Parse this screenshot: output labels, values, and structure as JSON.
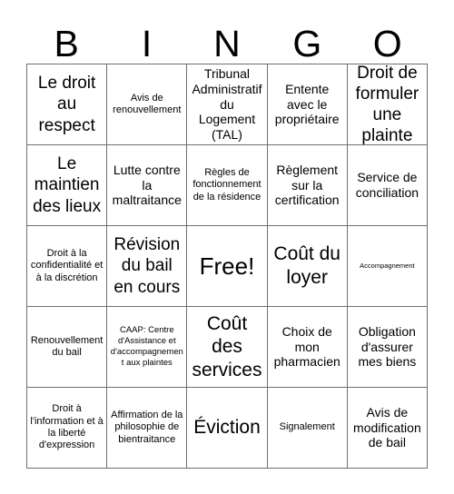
{
  "card": {
    "title": "BINGO",
    "header_letters": [
      "B",
      "I",
      "N",
      "G",
      "O"
    ],
    "border_color": "#6f6f6f",
    "background_color": "#ffffff",
    "text_color": "#000000",
    "rows": 5,
    "columns": 5,
    "cells": [
      {
        "text": "Le droit au respect",
        "size": "fs-lg"
      },
      {
        "text": "Avis de renouvellement",
        "size": "fs-sm"
      },
      {
        "text": "Tribunal Administratif du Logement (TAL)",
        "size": "fs-md"
      },
      {
        "text": "Entente avec le propriétaire",
        "size": "fs-md"
      },
      {
        "text": "Droit de formuler une plainte",
        "size": "fs-lg"
      },
      {
        "text": "Le maintien des lieux",
        "size": "fs-lg"
      },
      {
        "text": "Lutte contre la maltraitance",
        "size": "fs-md"
      },
      {
        "text": "Règles de fonctionnement de la résidence",
        "size": "fs-sm"
      },
      {
        "text": "Règlement sur la certification",
        "size": "fs-md"
      },
      {
        "text": "Service de conciliation",
        "size": "fs-md"
      },
      {
        "text": "Droit à la confidentialité et à la discrétion",
        "size": "fs-sm"
      },
      {
        "text": "Révision du bail en cours",
        "size": "fs-lg"
      },
      {
        "text": "Free!",
        "size": "free"
      },
      {
        "text": "Coût du loyer",
        "size": "fs-xl"
      },
      {
        "text": "Accompagnement",
        "size": "fs-xxs"
      },
      {
        "text": "Renouvellement du bail",
        "size": "fs-sm"
      },
      {
        "text": "CAAP: Centre d'Assistance et d'accompagnement aux plaintes",
        "size": "fs-xs"
      },
      {
        "text": "Coût des services",
        "size": "fs-xl"
      },
      {
        "text": "Choix de mon pharmacien",
        "size": "fs-md"
      },
      {
        "text": "Obligation d'assurer mes biens",
        "size": "fs-md"
      },
      {
        "text": "Droit à l'information et à la liberté d'expression",
        "size": "fs-sm"
      },
      {
        "text": "Affirmation de la philosophie de bientraitance",
        "size": "fs-sm"
      },
      {
        "text": "Éviction",
        "size": "fs-xl"
      },
      {
        "text": "Signalement",
        "size": "fs-sm"
      },
      {
        "text": "Avis de modification de bail",
        "size": "fs-md"
      }
    ]
  }
}
